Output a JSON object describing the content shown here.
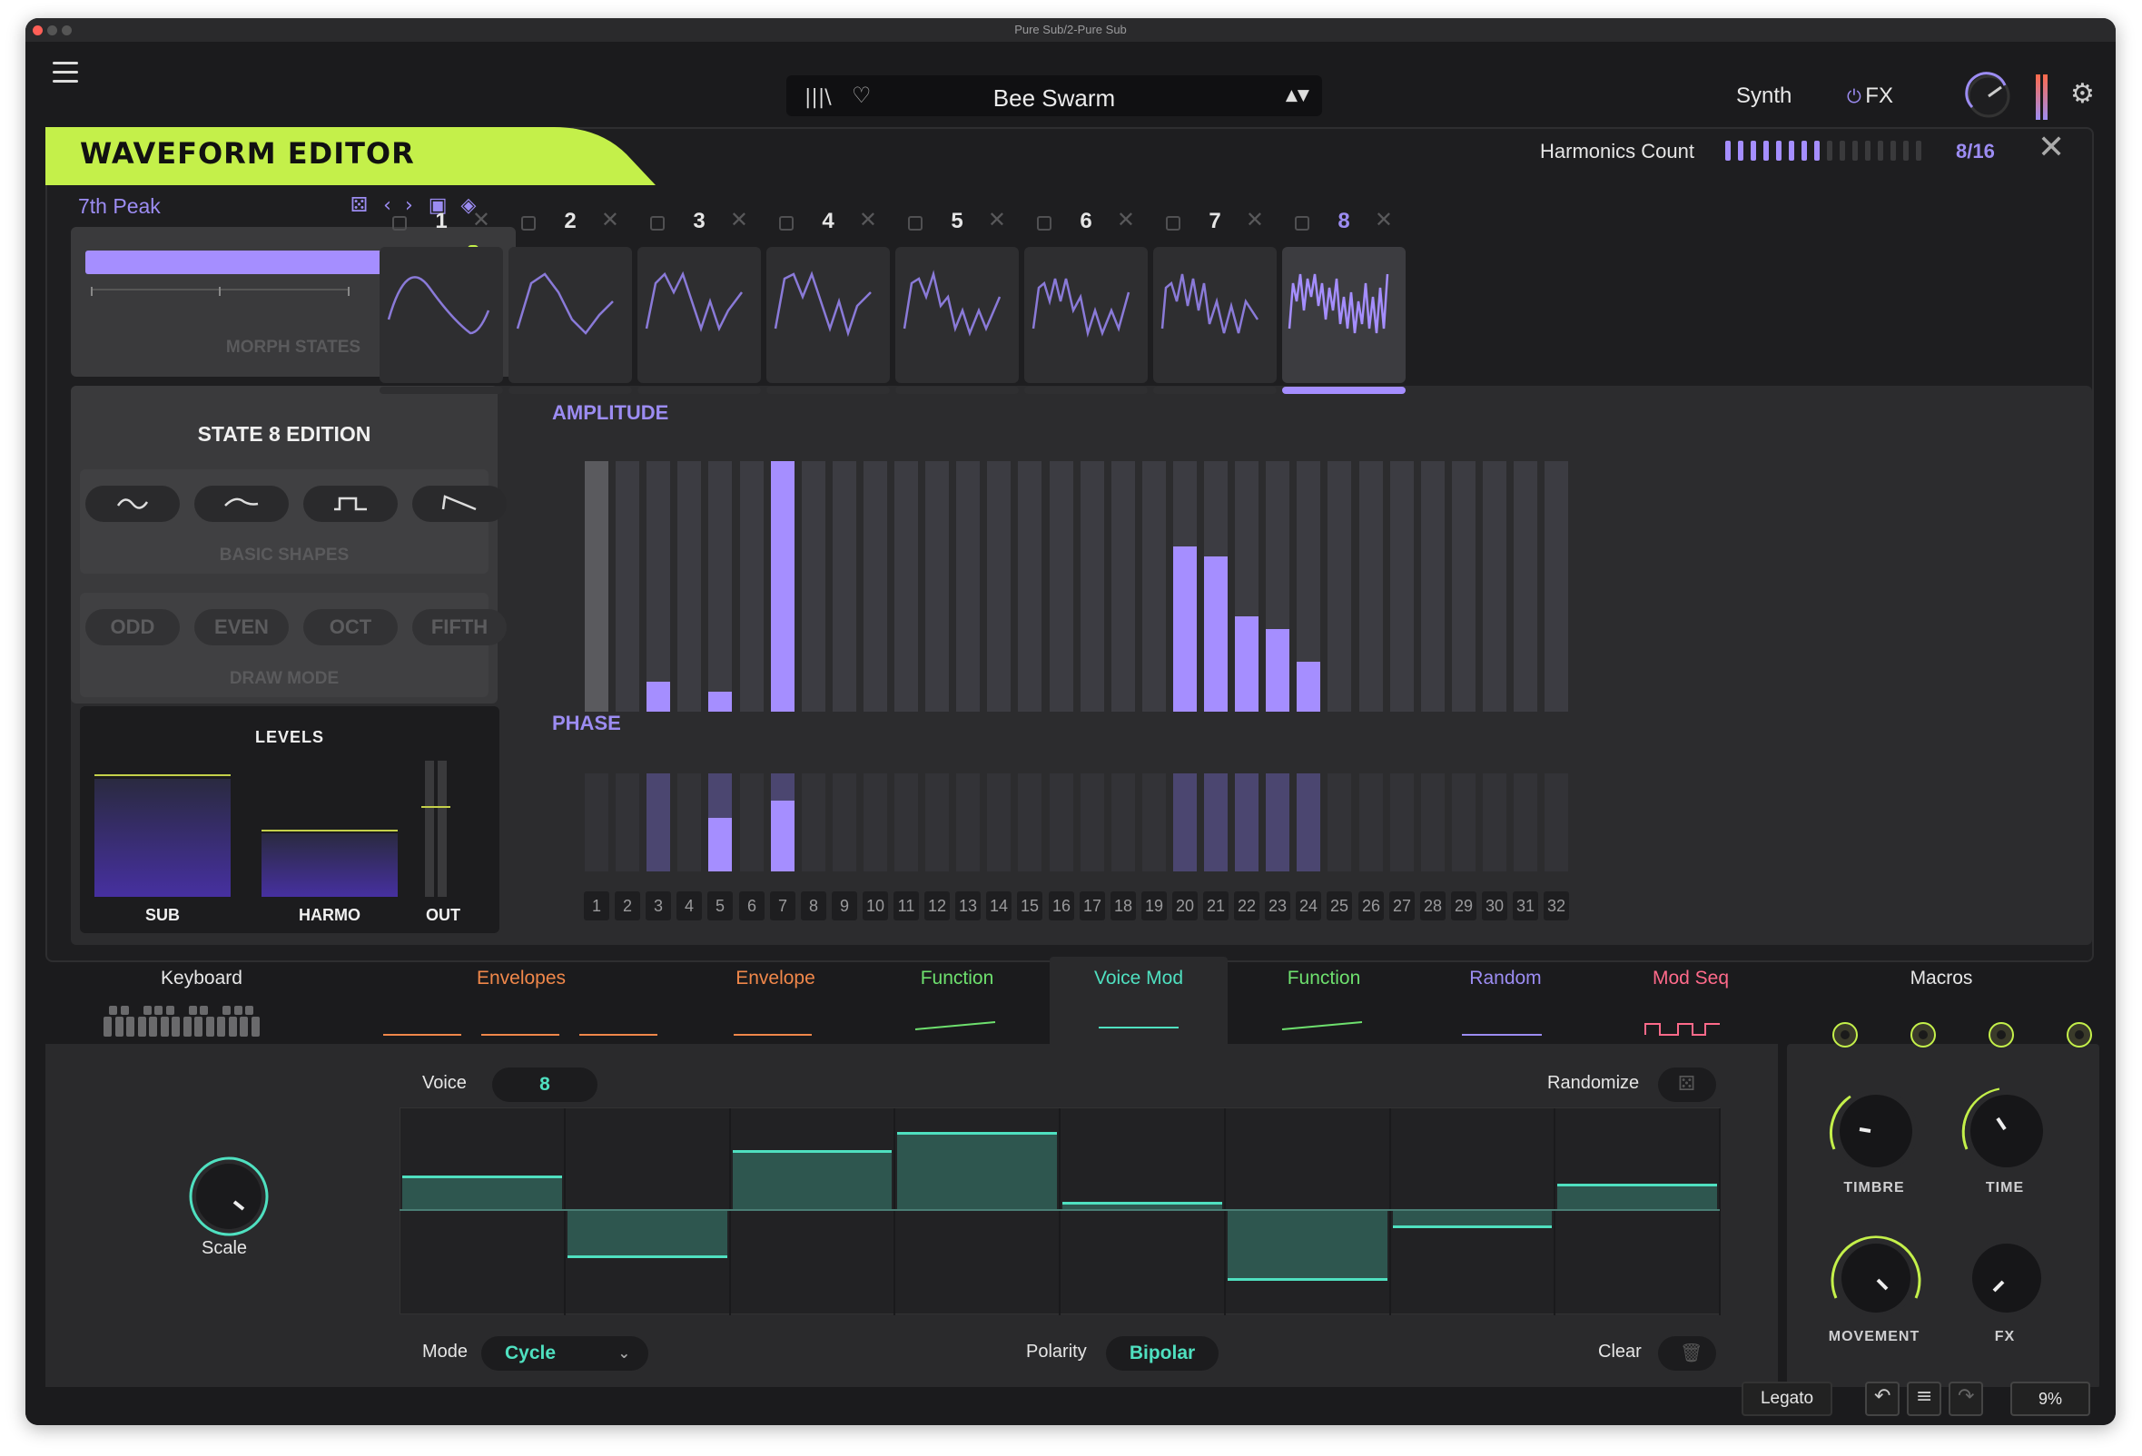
{
  "window": {
    "title": "Pure Sub/2-Pure Sub"
  },
  "topbar": {
    "preset_name": "Bee Swarm",
    "prev_next": "▲▼",
    "synth_tab": "Synth",
    "fx_tab": "FX"
  },
  "waveform_editor": {
    "title": "WAVEFORM EDITOR",
    "harmonics_label": "Harmonics Count",
    "harmonics_value": "8/16",
    "harmonics_fraction": 0.5,
    "preset_label": "7th Peak",
    "morph_label": "MORPH STATES",
    "morph_value": 0.97,
    "states": [
      "1",
      "2",
      "3",
      "4",
      "5",
      "6",
      "7",
      "8"
    ],
    "selected_state": 8
  },
  "state_edit": {
    "title": "STATE 8 EDITION",
    "basic_shapes_label": "BASIC SHAPES",
    "draw_mode_label": "DRAW MODE",
    "draw_modes": [
      "ODD",
      "EVEN",
      "OCT",
      "FIFTH"
    ],
    "shape_icons": [
      "sine-icon",
      "soft-sine-icon",
      "square-icon",
      "saw-icon"
    ]
  },
  "levels": {
    "title": "LEVELS",
    "sub": "SUB",
    "harmo": "HARMO",
    "out": "OUT"
  },
  "amplitude": {
    "label": "AMPLITUDE",
    "values": [
      1.0,
      0,
      0.12,
      0,
      0.08,
      0,
      1.0,
      0,
      0,
      0,
      0,
      0,
      0,
      0,
      0,
      0,
      0,
      0,
      0,
      0.66,
      0.62,
      0.38,
      0.33,
      0.2,
      0,
      0,
      0,
      0,
      0,
      0,
      0,
      0
    ]
  },
  "phase": {
    "label": "PHASE",
    "values": [
      0,
      0,
      0,
      0,
      0.55,
      0,
      0.72,
      0,
      0,
      0,
      0,
      0,
      0,
      0,
      0,
      0,
      0,
      0,
      0,
      0,
      0,
      0,
      0,
      0,
      0,
      0,
      0,
      0,
      0,
      0,
      0,
      0
    ],
    "active": [
      0,
      0,
      1,
      0,
      1,
      0,
      1,
      0,
      0,
      0,
      0,
      0,
      0,
      0,
      0,
      0,
      0,
      0,
      0,
      1,
      1,
      1,
      1,
      1,
      0,
      0,
      0,
      0,
      0,
      0,
      0,
      0
    ],
    "numbers": [
      "1",
      "2",
      "3",
      "4",
      "5",
      "6",
      "7",
      "8",
      "9",
      "10",
      "11",
      "12",
      "13",
      "14",
      "15",
      "16",
      "17",
      "18",
      "19",
      "20",
      "21",
      "22",
      "23",
      "24",
      "25",
      "26",
      "27",
      "28",
      "29",
      "30",
      "31",
      "32"
    ]
  },
  "mod_tabs": [
    {
      "label": "Keyboard",
      "color": "#e6e6e6"
    },
    {
      "label": "Envelopes",
      "color": "#f0874a"
    },
    {
      "label": "Envelope",
      "color": "#f0874a"
    },
    {
      "label": "Function",
      "color": "#6ee06e"
    },
    {
      "label": "Voice Mod",
      "color": "#4fe0c0"
    },
    {
      "label": "Function",
      "color": "#6ee06e"
    },
    {
      "label": "Random",
      "color": "#9c8cf2"
    },
    {
      "label": "Mod Seq",
      "color": "#ff6a8a"
    },
    {
      "label": "Macros",
      "color": "#e6e6e6"
    }
  ],
  "voice_mod": {
    "voice_label": "Voice",
    "voice_value": "8",
    "randomize_label": "Randomize",
    "scale_label": "Scale",
    "mode_label": "Mode",
    "mode_value": "Cycle",
    "polarity_label": "Polarity",
    "polarity_value": "Bipolar",
    "clear_label": "Clear",
    "steps": [
      0.35,
      -0.45,
      0.6,
      0.78,
      0.08,
      -0.68,
      -0.15,
      0.26
    ]
  },
  "macros": {
    "timbre": "TIMBRE",
    "time": "TIME",
    "movement": "MOVEMENT",
    "fx": "FX"
  },
  "status": {
    "legato": "Legato",
    "cpu": "9%"
  },
  "colors": {
    "accent": "#a58eff",
    "lime": "#c4f04a",
    "teal": "#4fe0c0"
  }
}
